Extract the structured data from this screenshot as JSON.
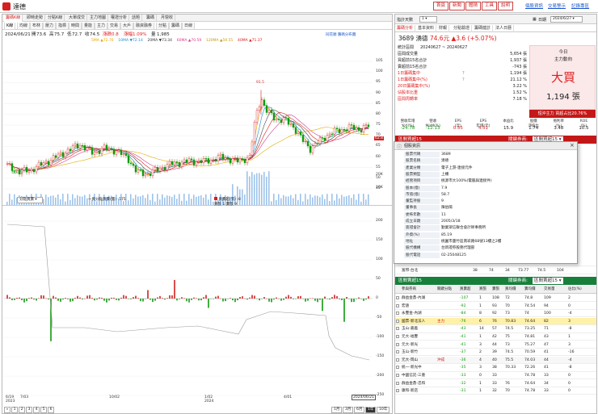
{
  "window": {
    "title": "達德",
    "buttons": [
      "首頁",
      "新聞",
      "體積",
      "工具",
      "說明"
    ],
    "links": [
      "個股資訊",
      "交易警示",
      "記錄專區"
    ]
  },
  "chart": {
    "tabs_top": [
      "籌碼K線",
      "即時走勢",
      "分點K線",
      "大單成交",
      "主力地圖",
      "權證分析",
      "話題",
      "籌碼",
      "月營收"
    ],
    "tabs_second": [
      "K線",
      "均線",
      "布林",
      "壓力",
      "指標",
      "時間",
      "量能",
      "主力",
      "交易",
      "大戶",
      "融資融券",
      "分點",
      "籌碼",
      "日線"
    ],
    "info_date": "2024/06/21",
    "info_items": [
      {
        "label": "開",
        "value": "73.6"
      },
      {
        "label": "高",
        "value": "75.7"
      },
      {
        "label": "低",
        "value": "72.7"
      },
      {
        "label": "收",
        "value": "74.5"
      },
      {
        "label": "漲跌",
        "value": "0.8"
      },
      {
        "label": "漲幅",
        "value": "1.09%"
      },
      {
        "label": "量",
        "value": "1,985"
      }
    ],
    "top_right_link": "同花順 籌碼分布圖",
    "ma_legend": [
      {
        "label": "5MA",
        "value": "▲72.76",
        "color": "#e8a400"
      },
      {
        "label": "10MA",
        "value": "▼72.14",
        "color": "#1c8cd6"
      },
      {
        "label": "20MA",
        "value": "▼73.34",
        "color": "#333"
      },
      {
        "label": "60MA",
        "value": "▲70.59",
        "color": "#d43c8c"
      },
      {
        "label": "120MA",
        "value": "▲59.55",
        "color": "#e0b000"
      },
      {
        "label": "40MA",
        "value": "▲71.37",
        "color": "#d42020"
      }
    ],
    "price_axis": [
      "105",
      "100",
      "95",
      "90",
      "85",
      "80",
      "75",
      "70",
      "65",
      "60",
      "55",
      "50",
      "45"
    ],
    "last_price_label": "62.8",
    "high_marker": "91.5",
    "low_marker": "50.43",
    "volume_axis": [
      "20K",
      "10K"
    ],
    "lower_select": "分點買賣",
    "lower_legend": [
      {
        "label": "一買分點買賣(張)",
        "value": "-575",
        "color": "#222"
      },
      {
        "label": "買賣超(張)",
        "value": "-8",
        "color": "#d42020"
      },
      {
        "label": "買賣超(張)",
        "value": "9",
        "color": "#109a10"
      }
    ],
    "lower_legend_extra": "買張 1  賣張 9",
    "lower_axis": [
      "200",
      "150",
      "100",
      "50",
      "0",
      "-50",
      "-100",
      "-150",
      "-200",
      "-250"
    ],
    "x_axis": [
      "6/19",
      "7/03",
      "10/02",
      "1/02",
      "4/01",
      "2024/06/21"
    ],
    "x_years": [
      "2023",
      "2024"
    ],
    "pager": [
      "1",
      "2",
      "3",
      "4",
      "5",
      "6"
    ],
    "periods": [
      "1月",
      "3月",
      "6月",
      "1年",
      "10年"
    ],
    "period_selected": "1年"
  },
  "right": {
    "header_select_label": "指計天數",
    "header_select_value": "1",
    "date_label": "日期",
    "date_value": "2024/6/27",
    "tabs": [
      "籌碼分析",
      "基本資料",
      "財報",
      "分點驗證",
      "籌碼健診",
      "法人日曆"
    ],
    "stock_code": "3689",
    "stock_name": "湧德",
    "price": "74.6元",
    "change": "▲3.6 (+5.07%)",
    "stats_title": "統計區間",
    "stats_range": "20240627 ~ 20240627",
    "stats": [
      {
        "label": "區間成交量",
        "value": "5,654 張"
      },
      {
        "label": "買超前15名合計",
        "value": "1,937 張"
      },
      {
        "label": "賣超前15名合計",
        "value": "-743 張"
      },
      {
        "label": "1日籌碼集中",
        "value": "1,194 張"
      },
      {
        "label": "1日籌碼集中(%)",
        "value": "21.12 %"
      },
      {
        "label": "20日籌碼集中(%)",
        "value": "3.22 %"
      },
      {
        "label": "佔股本比重",
        "value": "1.52 %"
      },
      {
        "label": "區間周轉率",
        "value": "7.18 %"
      }
    ],
    "big_today": "今日",
    "big_sub": "主力動向",
    "big_action": "大買",
    "big_amount": "1,194 張",
    "bar_text": "短沖主力  買超占比20.76%",
    "fin_headers": [
      "營收年增\nYoY(%)",
      "營收\nMoM(%)",
      "EPS\n(元)",
      "EPS\n年增(元)",
      "本益比",
      "股價\n淨值比",
      "殖利率\n(%)",
      "ROE\n(%)"
    ],
    "fin_values": [
      "-24.78",
      "-12.13",
      "0.55",
      "4.51",
      "15.9",
      "1.74",
      "3.48",
      "10.5"
    ],
    "buy_section": "區間買超15",
    "buy_filter_label": "關鍵券商:",
    "buy_filter_value": "區間買超15",
    "sell_section": "區間賣超15",
    "sell_filter_label": "關鍵券商:",
    "sell_filter_value": "區間賣超15",
    "buy_partial_rows": [
      {
        "name": "凱基",
        "c1": "43",
        "c2": "52",
        "c3": "12",
        "c4": "74.86",
        "c5": "73.33",
        "c6": "64"
      },
      {
        "name": "富邦-台北",
        "c1": "38",
        "c2": "74",
        "c3": "34",
        "c4": "73.77",
        "c5": "74.5",
        "c6": "104"
      }
    ],
    "table_headers": [
      "參與券商",
      "關鍵分點",
      "買賣超",
      "買張",
      "賣張",
      "買均價",
      "賣均價",
      "交易量",
      "佔比(%)"
    ],
    "sell_rows": [
      {
        "name": "群益金鼎-內湖",
        "tag": "",
        "net": "-107",
        "buy": "1",
        "sell": "108",
        "bavg": "72",
        "savg": "74.8",
        "vol": "109",
        "pct": "2"
      },
      {
        "name": "宏遠",
        "tag": "",
        "net": "-92",
        "buy": "1",
        "sell": "93",
        "bavg": "70",
        "savg": "74.54",
        "vol": "94",
        "pct": "0"
      },
      {
        "name": "永豐金-內湖",
        "tag": "",
        "net": "-84",
        "buy": "8",
        "sell": "92",
        "bavg": "73",
        "savg": "74",
        "vol": "100",
        "pct": "-4"
      },
      {
        "name": "國票-新北法人",
        "tag": "主力",
        "net": "-76",
        "buy": "6",
        "sell": "76",
        "bavg": "70.83",
        "savg": "74.64",
        "vol": "82",
        "pct": "3"
      },
      {
        "name": "玉山-嘉義",
        "tag": "",
        "net": "-43",
        "buy": "14",
        "sell": "57",
        "bavg": "74.5",
        "savg": "73.25",
        "vol": "71",
        "pct": "-8"
      },
      {
        "name": "元大-福豐",
        "tag": "",
        "net": "-41",
        "buy": "1",
        "sell": "42",
        "bavg": "75",
        "savg": "74.81",
        "vol": "43",
        "pct": "1"
      },
      {
        "name": "元大-新光",
        "tag": "",
        "net": "-41",
        "buy": "3",
        "sell": "44",
        "bavg": "73",
        "savg": "75.27",
        "vol": "47",
        "pct": "3"
      },
      {
        "name": "玉山-新竹",
        "tag": "",
        "net": "-37",
        "buy": "2",
        "sell": "39",
        "bavg": "74.5",
        "savg": "70.59",
        "vol": "41",
        "pct": "-16"
      },
      {
        "name": "元大-岡山",
        "tag": "沖成",
        "net": "-36",
        "buy": "4",
        "sell": "40",
        "bavg": "75.5",
        "savg": "74.03",
        "vol": "44",
        "pct": "-4"
      },
      {
        "name": "統一-新光中",
        "tag": "",
        "net": "-35",
        "buy": "3",
        "sell": "38",
        "bavg": "70.33",
        "savg": "72.26",
        "vol": "41",
        "pct": "-8"
      },
      {
        "name": "中國信託-三重",
        "tag": "",
        "net": "-33",
        "buy": "0",
        "sell": "33",
        "bavg": "",
        "savg": "74.78",
        "vol": "33",
        "pct": "0"
      },
      {
        "name": "群益金鼎-忠和",
        "tag": "",
        "net": "-32",
        "buy": "1",
        "sell": "33",
        "bavg": "76",
        "savg": "74.64",
        "vol": "34",
        "pct": "0"
      },
      {
        "name": "康和-新店",
        "tag": "",
        "net": "-31",
        "buy": "1",
        "sell": "32",
        "bavg": "70",
        "savg": "74.78",
        "vol": "33",
        "pct": "0"
      }
    ]
  },
  "popup": {
    "title": "個股資訊",
    "rows": [
      {
        "k": "股票代碼",
        "v": "3689"
      },
      {
        "k": "股票名稱",
        "v": "湧德"
      },
      {
        "k": "產業分類",
        "v": "電子上游-連接元件"
      },
      {
        "k": "股票類型",
        "v": "上櫃"
      },
      {
        "k": "經營項目",
        "v": "桃源市大100%(電腦與連接件)"
      },
      {
        "k": "股本(億)",
        "v": "7.9"
      },
      {
        "k": "市值(億)",
        "v": "58.7"
      },
      {
        "k": "董監持股",
        "v": "9"
      },
      {
        "k": "董事長",
        "v": "陳伯陽"
      },
      {
        "k": "委佈年數",
        "v": "11"
      },
      {
        "k": "成立日期",
        "v": "2005/3/18"
      },
      {
        "k": "簽證會計",
        "v": "勤業眾信聯合會計師事務所"
      },
      {
        "k": "外資(%)",
        "v": "85.19"
      },
      {
        "k": "地址",
        "v": "桃園市蘆竹區南崁路68號13樓之2樓"
      },
      {
        "k": "股代機構",
        "v": "台新證券股務代理部"
      },
      {
        "k": "股代電話",
        "v": "02-25048125"
      }
    ]
  }
}
